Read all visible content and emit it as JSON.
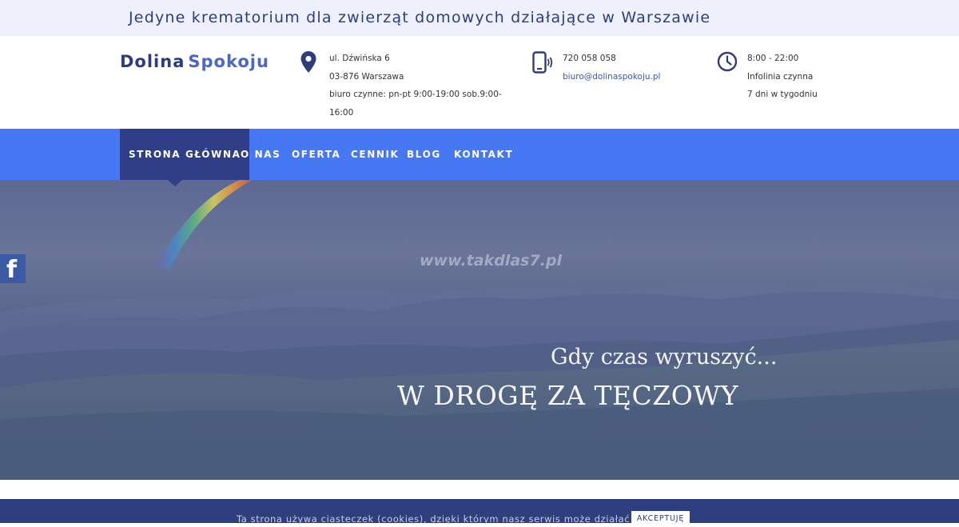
{
  "topbar": {
    "tagline": "Jedyne krematorium dla zwierząt domowych działające w Warszawie"
  },
  "header": {
    "logo": {
      "part1": "Dolina",
      "part2": "Spokoju"
    },
    "address": {
      "icon": "map-pin-icon",
      "lines": [
        "ul. Dźwińska 6",
        "03-876 Warszawa",
        "biuro czynne: pn-pt 9:00-19:00 sob.9:00-",
        "16:00"
      ]
    },
    "contact": {
      "icon": "phone-icon",
      "phone": "720 058 058",
      "email": "biuro@dolinaspokoju.pl"
    },
    "hours": {
      "icon": "clock-icon",
      "lines": [
        "8:00 - 22:00",
        "Infolinia czynna",
        "7 dni w tygodniu"
      ]
    }
  },
  "nav": {
    "items": [
      {
        "label": "STRONA GŁÓWNA",
        "active": true
      },
      {
        "label": "O NAS"
      },
      {
        "label": "OFERTA"
      },
      {
        "label": "CENNIK"
      },
      {
        "label": "BLOG"
      },
      {
        "label": "KONTAKT"
      }
    ]
  },
  "hero": {
    "watermark": "www.takdlas7.pl",
    "subtitle": "Gdy czas wyruszyć...",
    "title": "W DROGĘ ZA TĘCZOWY"
  },
  "social": {
    "facebook_icon": "facebook-icon",
    "facebook_glyph": "f"
  },
  "cookie": {
    "text": "Ta strona używa ciasteczek (cookies), dzięki którym nasz serwis może działać lepiej.",
    "button": "AKCEPTUJĘ"
  },
  "colors": {
    "nav_bg": "#4578f2",
    "nav_active": "#2f3e86",
    "brand_dark": "#2f3b7b",
    "brand_light": "#4a66c8",
    "cookie_bg": "#2f3e7c"
  }
}
